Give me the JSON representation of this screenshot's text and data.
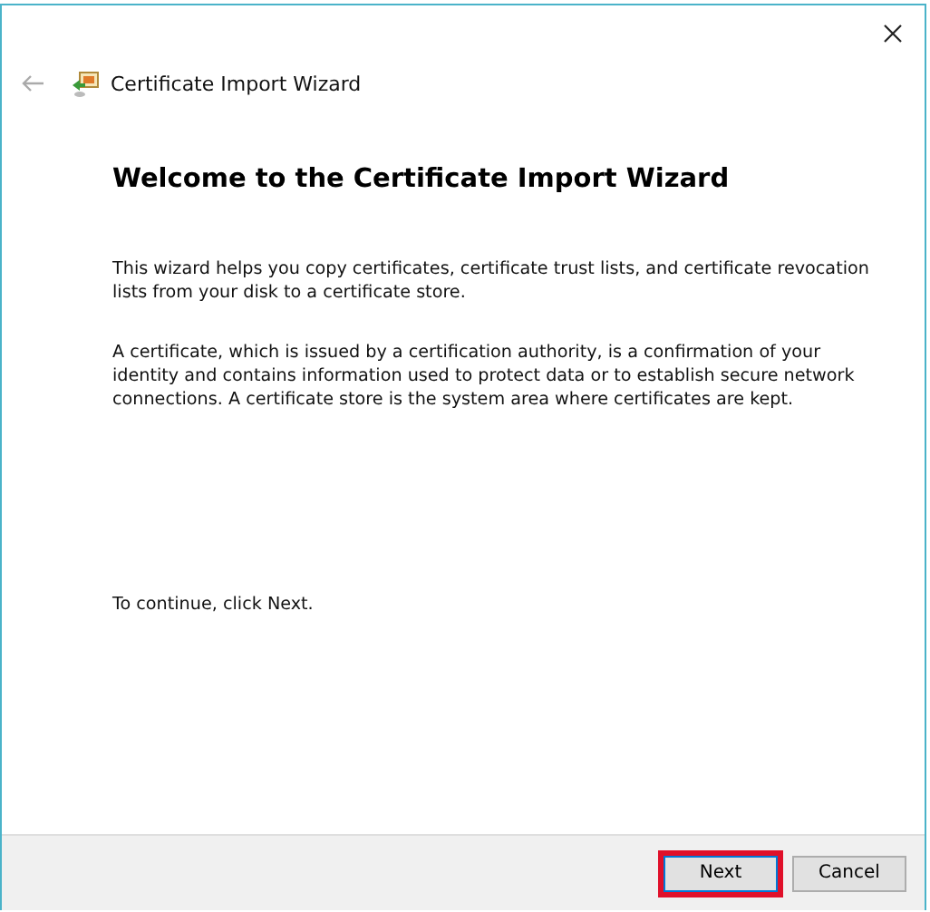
{
  "window": {
    "title": "Certificate Import Wizard"
  },
  "heading": "Welcome to the Certificate Import Wizard",
  "paragraphs": [
    "This wizard helps you copy certificates, certificate trust lists, and certificate revocation lists from your disk to a certificate store.",
    "A certificate, which is issued by a certification authority, is a confirmation of your identity and contains information used to protect data or to establish secure network connections. A certificate store is the system area where certificates are kept."
  ],
  "continue_text": "To continue, click Next.",
  "buttons": [
    {
      "label": "Next",
      "highlighted": true
    },
    {
      "label": "Cancel",
      "highlighted": false
    }
  ]
}
